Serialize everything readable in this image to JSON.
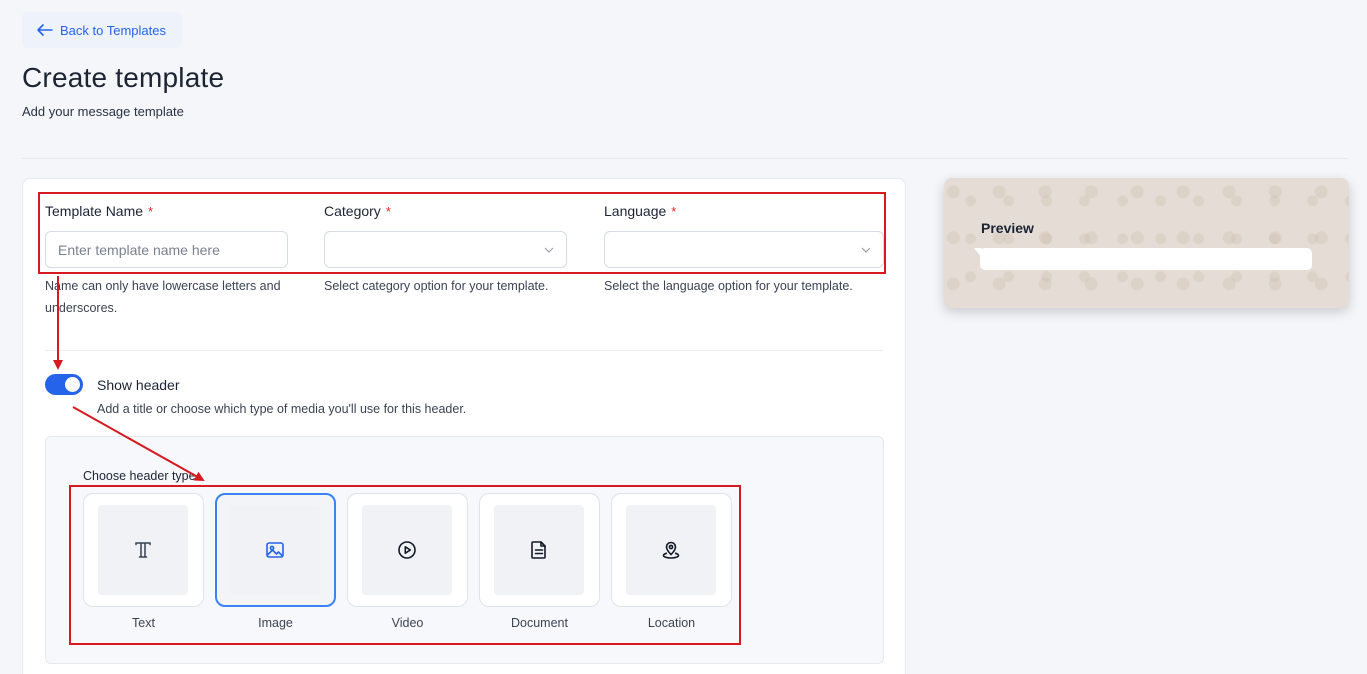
{
  "nav": {
    "back_label": "Back to Templates"
  },
  "header": {
    "title": "Create template",
    "subtitle": "Add your message template"
  },
  "form": {
    "template_name": {
      "label": "Template Name",
      "required_mark": "*",
      "placeholder": "Enter template name here",
      "value": "",
      "help": "Name can only have lowercase letters and underscores."
    },
    "category": {
      "label": "Category",
      "required_mark": "*",
      "value": "",
      "help": "Select category option for your template."
    },
    "language": {
      "label": "Language",
      "required_mark": "*",
      "value": "",
      "help": "Select the language option for your template."
    }
  },
  "show_header": {
    "label": "Show header",
    "description": "Add a title or choose which type of media you'll use for this header.",
    "enabled": true
  },
  "header_type": {
    "label": "Choose header type",
    "selected": "Image",
    "options": [
      {
        "label": "Text",
        "icon": "text-format-icon"
      },
      {
        "label": "Image",
        "icon": "image-icon"
      },
      {
        "label": "Video",
        "icon": "play-circle-icon"
      },
      {
        "label": "Document",
        "icon": "document-icon"
      },
      {
        "label": "Location",
        "icon": "location-pin-icon"
      }
    ]
  },
  "preview": {
    "title": "Preview"
  },
  "colors": {
    "accent": "#2563eb",
    "required": "#e02424",
    "annotation": "#d71920",
    "preview_bg": "#e5ddd5"
  }
}
